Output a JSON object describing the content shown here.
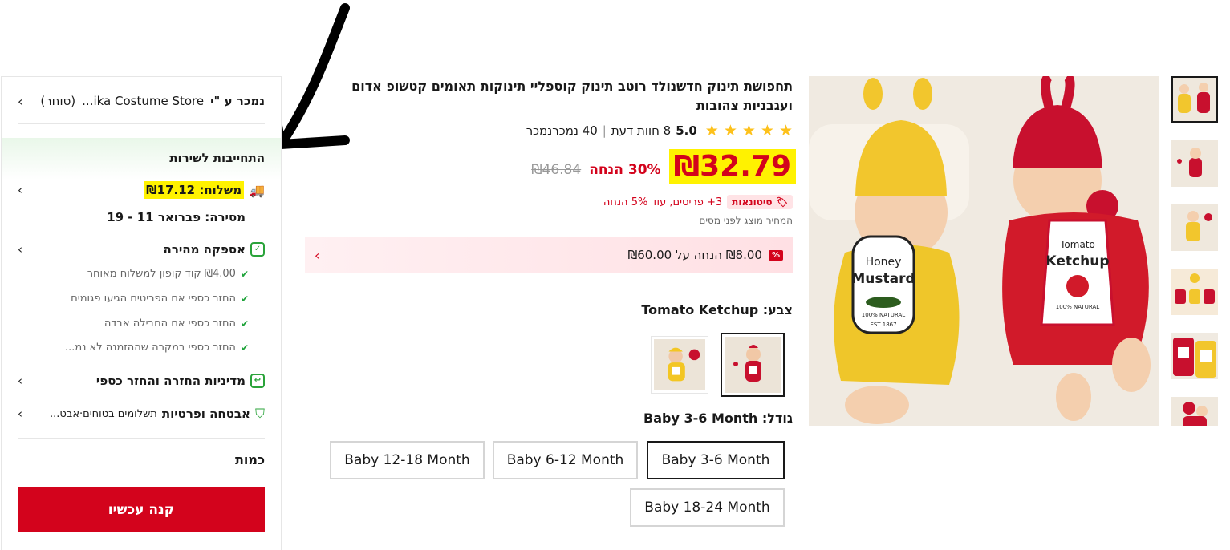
{
  "side_panel": {
    "sold_by_label": "נמכר ע \"י",
    "store_name": "ika Costume Store...",
    "seller_type": "(סוחר)",
    "service_title": "התחייבות לשירות",
    "shipping_label": "משלוח: ₪17.12",
    "delivery_label": "מסירה: פברואר 11 - 19",
    "fast_delivery": "אספקה מהירה",
    "guarantees": [
      "₪4.00 קוד קופון למשלוח מאוחר",
      "החזר כספי אם הפריטים הגיעו פגומים",
      "החזר כספי אם החבילה אבדה",
      "החזר כספי במקרה שההזמנה לא נמ..."
    ],
    "return_policy": "מדיניות החזרה והחזר כספי",
    "security_title": "אבטחה ופרטיות",
    "security_sub": "תשלומים בטוחים·אבט...",
    "quantity_label": "כמות",
    "buy_now": "קנה עכשיו"
  },
  "product": {
    "title": "תחפושת תינוק חדשנולד רוטב תינוק קוספליי תינוקות תאומים קטשופ אדום ועגבניות צהובות",
    "rating_score": "5.0",
    "reviews": "8 חוות דעת",
    "sold": "40 נמכרנמכר",
    "price": "₪32.79",
    "discount": "30% הנחה",
    "old_price": "₪46.84",
    "bulk_badge": "סיטונאות",
    "bulk_text": "3+ פריטים, עוד 5% הנחה",
    "tax_note": "המחיר מוצג לפני מסים",
    "coupon_pct": "%",
    "coupon_text": "₪8.00 הנחה על ₪60.00",
    "color_label": "צבע: Tomato Ketchup",
    "size_label": "גודל: Baby 3-6 Month",
    "sizes": [
      "Baby 3-6 Month",
      "Baby 6-12 Month",
      "Baby 12-18 Month",
      "Baby 18-24 Month"
    ],
    "selected_size": "Baby 3-6 Month",
    "image_text": {
      "mustard_top": "Honey",
      "mustard_main": "Mustard",
      "mustard_natural": "100% NATURAL",
      "mustard_est": "EST 1867",
      "ketchup_top": "Tomato",
      "ketchup_main": "Ketchup",
      "ketchup_natural": "100% NATURAL"
    }
  },
  "colors": {
    "accent_red": "#d3031c",
    "highlight_yellow": "#fff200",
    "star": "#fdc11b",
    "green": "#2aa33a"
  }
}
